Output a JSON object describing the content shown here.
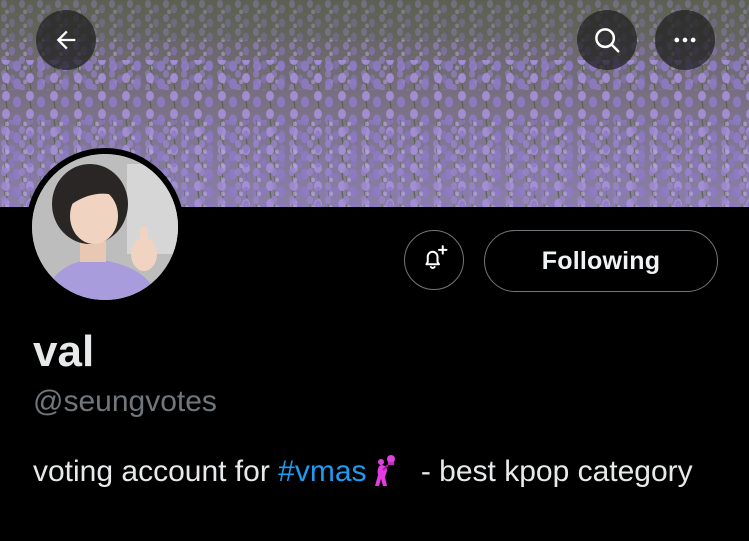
{
  "header": {
    "back_icon": "arrow-left-icon",
    "search_icon": "search-icon",
    "more_icon": "more-horizontal-icon"
  },
  "banner": {
    "description_icon": "lavender-field-banner"
  },
  "profile": {
    "display_name": "val",
    "handle": "@seungvotes",
    "bio_before": "voting account for ",
    "bio_hashtag": "#vmas",
    "bio_emoji": "microphone-singer-emoji",
    "bio_after": " - best kpop category"
  },
  "actions": {
    "notify_icon": "bell-plus-icon",
    "follow_label": "Following"
  },
  "colors": {
    "background": "#000000",
    "hashtag": "#1d9bf0",
    "muted": "#71767b",
    "text": "#e7e9ea"
  }
}
